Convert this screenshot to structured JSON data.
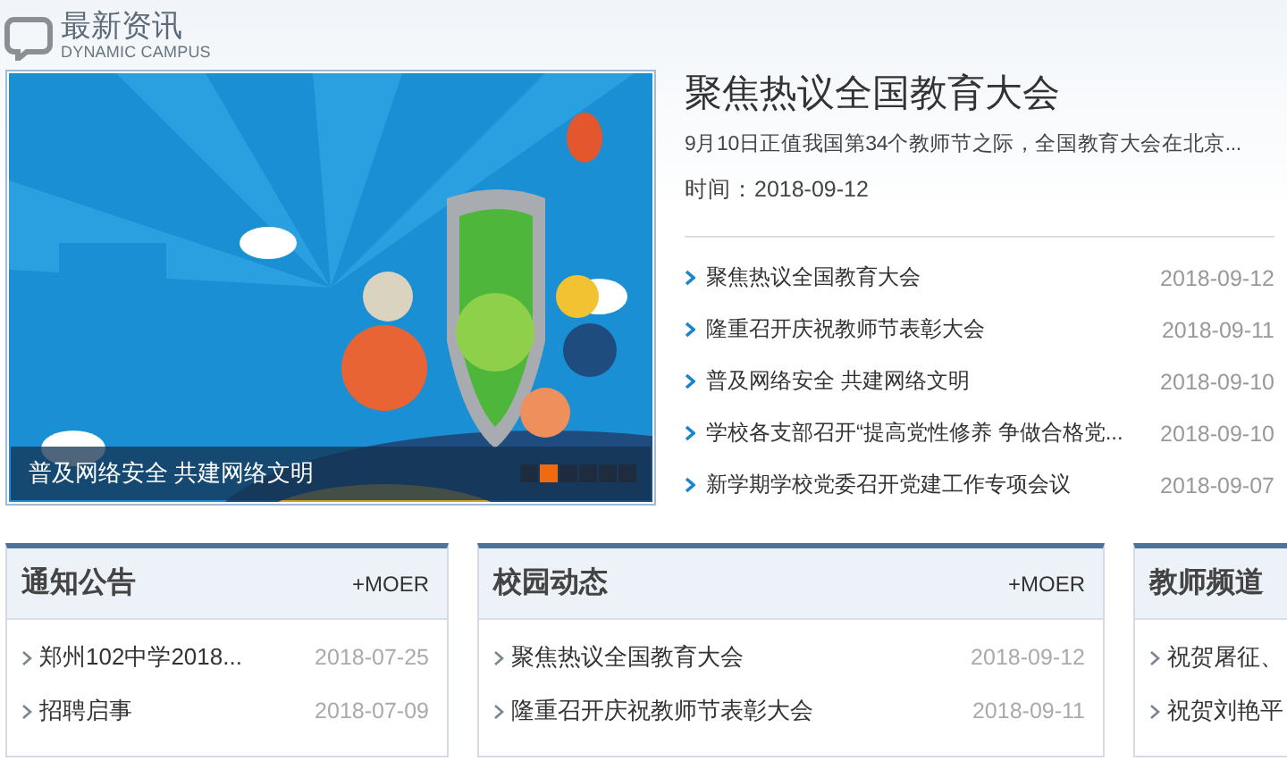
{
  "header": {
    "title": "最新资讯",
    "subtitle": "DYNAMIC CAMPUS"
  },
  "banner": {
    "caption": "普及网络安全 共建网络文明",
    "slides": [
      {
        "selected": false
      },
      {
        "selected": true
      },
      {
        "selected": false
      },
      {
        "selected": false
      },
      {
        "selected": false
      },
      {
        "selected": false
      }
    ]
  },
  "headline": {
    "title": "聚焦热议全国教育大会",
    "summary": "9月10日正值我国第34个教师节之际，全国教育大会在北京...",
    "time": "时间：2018-09-12"
  },
  "news": [
    {
      "title": "聚焦热议全国教育大会",
      "date": "2018-09-12"
    },
    {
      "title": "隆重召开庆祝教师节表彰大会",
      "date": "2018-09-11"
    },
    {
      "title": "普及网络安全 共建网络文明",
      "date": "2018-09-10"
    },
    {
      "title": "学校各支部召开“提高党性修养 争做合格党...",
      "date": "2018-09-10"
    },
    {
      "title": "新学期学校党委召开党建工作专项会议",
      "date": "2018-09-07"
    }
  ],
  "panels": [
    {
      "title": "通知公告",
      "more": "+MOER",
      "items": [
        {
          "title": "郑州102中学2018...",
          "date": "2018-07-25"
        },
        {
          "title": "招聘启事",
          "date": "2018-07-09"
        }
      ]
    },
    {
      "title": "校园动态",
      "more": "+MOER",
      "items": [
        {
          "title": "聚焦热议全国教育大会",
          "date": "2018-09-12"
        },
        {
          "title": "隆重召开庆祝教师节表彰大会",
          "date": "2018-09-11"
        }
      ]
    },
    {
      "title": "教师频道",
      "items": [
        {
          "title": "祝贺屠征、"
        },
        {
          "title": "祝贺刘艳平"
        }
      ]
    }
  ]
}
